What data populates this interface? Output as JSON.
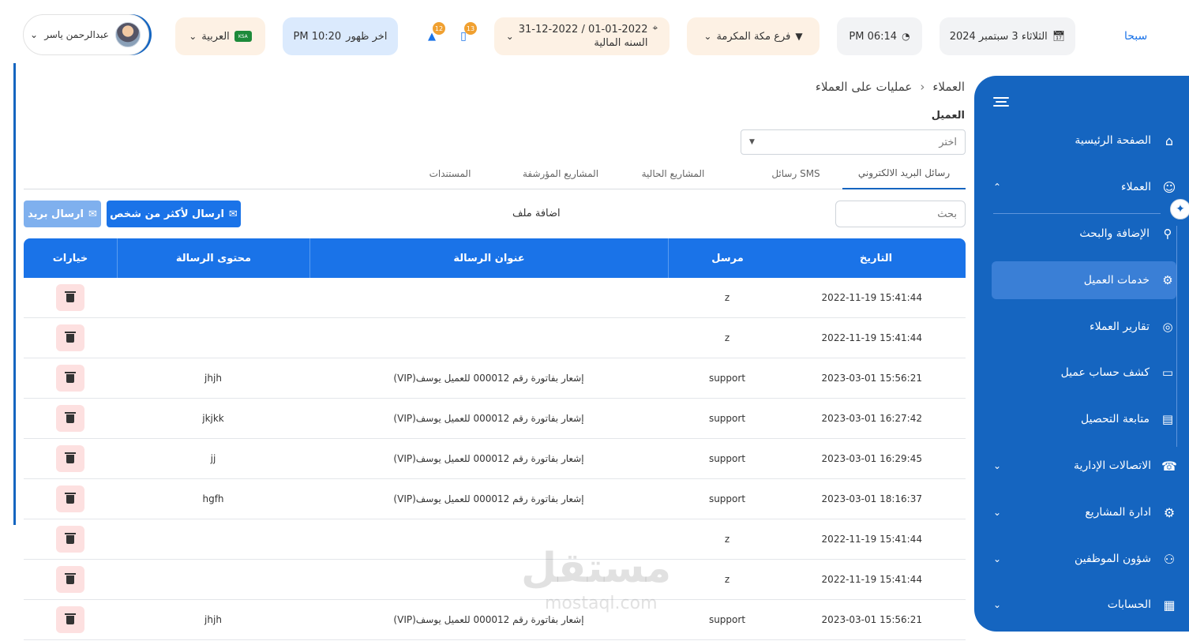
{
  "header": {
    "brand": "سبحا",
    "date": "الثلاثاء 3 سبتمبر 2024",
    "time": "PM 06:14",
    "branch": "فرع مكة المكرمة",
    "fiscal_range": "31-12-2022 / 01-01-2022",
    "fiscal_label": "السنه المالية",
    "cart_count": "13",
    "notif_count": "12",
    "prayer": "اخر ظهور",
    "prayer_time": "PM 10:20",
    "language": "العربية",
    "flag_text": "KSA",
    "user_name": "عبدالرحمن ياسر"
  },
  "sidebar": {
    "items": [
      {
        "label": "الصفحة الرئيسية",
        "icon": "home-icon"
      },
      {
        "label": "العملاء",
        "icon": "users-icon"
      },
      {
        "label": "الإضافة والبحث",
        "icon": "search-icon"
      },
      {
        "label": "خدمات العميل",
        "icon": "gear-icon"
      },
      {
        "label": "تقارير العملاء",
        "icon": "user-circle-icon"
      },
      {
        "label": "كشف حساب عميل",
        "icon": "wallet-icon"
      },
      {
        "label": "متابعة التحصيل",
        "icon": "clipboard-icon"
      },
      {
        "label": "الاتصالات الإدارية",
        "icon": "headset-icon"
      },
      {
        "label": "ادارة المشاريع",
        "icon": "settings-icon"
      },
      {
        "label": "شؤون الموظفين",
        "icon": "team-icon"
      },
      {
        "label": "الحسابات",
        "icon": "calculator-icon"
      }
    ]
  },
  "breadcrumb": {
    "root": "العملاء",
    "sep": "‹",
    "current": "عمليات على العملاء"
  },
  "client": {
    "label": "العميل",
    "placeholder": "اختر"
  },
  "tabs": [
    "رسائل البريد الالكتروني",
    "رسائل SMS",
    "المشاريع الحالية",
    "المشاريع المؤرشفة",
    "المستندات"
  ],
  "toolbar": {
    "search_placeholder": "بحث",
    "attach_label": "اضافة ملف",
    "send_multi": "ارسال لأكثر من شخص",
    "send_mail": "ارسال بريد"
  },
  "table": {
    "headers": {
      "date": "التاريخ",
      "sender": "مرسل",
      "subject": "عنوان الرسالة",
      "content": "محتوى الرسالة",
      "options": "خيارات"
    },
    "rows": [
      {
        "date": "2022-11-19 15:41:44",
        "sender": "z",
        "subject": "",
        "content": ""
      },
      {
        "date": "2022-11-19 15:41:44",
        "sender": "z",
        "subject": "",
        "content": ""
      },
      {
        "date": "2023-03-01 15:56:21",
        "sender": "support",
        "subject": "إشعار بفاتورة رقم 000012 للعميل يوسف(VIP)",
        "content": "jhjh"
      },
      {
        "date": "2023-03-01 16:27:42",
        "sender": "support",
        "subject": "إشعار بفاتورة رقم 000012 للعميل يوسف(VIP)",
        "content": "jkjkk"
      },
      {
        "date": "2023-03-01 16:29:45",
        "sender": "support",
        "subject": "إشعار بفاتورة رقم 000012 للعميل يوسف(VIP)",
        "content": "jj"
      },
      {
        "date": "2023-03-01 18:16:37",
        "sender": "support",
        "subject": "إشعار بفاتورة رقم 000012 للعميل يوسف(VIP)",
        "content": "hgfh"
      },
      {
        "date": "2022-11-19 15:41:44",
        "sender": "z",
        "subject": "",
        "content": ""
      },
      {
        "date": "2022-11-19 15:41:44",
        "sender": "z",
        "subject": "",
        "content": ""
      },
      {
        "date": "2023-03-01 15:56:21",
        "sender": "support",
        "subject": "إشعار بفاتورة رقم 000012 للعميل يوسف(VIP)",
        "content": "jhjh"
      }
    ]
  },
  "watermark": {
    "main": "مستقل",
    "sub": "mostaql.com"
  },
  "colors": {
    "primary": "#1565c0",
    "accent": "#1a73e8",
    "danger_bg": "#fde0e0"
  }
}
